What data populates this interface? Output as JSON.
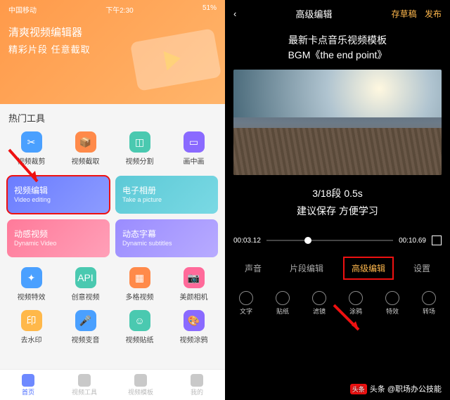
{
  "left": {
    "status": {
      "carrier": "中国移动",
      "time": "下午2:30",
      "battery": "51%"
    },
    "app_name": "清爽视频编辑器",
    "tagline": "精彩片段 任意截取",
    "section_hot": "热门工具",
    "tools_row1": [
      {
        "label": "视频裁剪",
        "color": "#4aa0ff"
      },
      {
        "label": "视频截取",
        "color": "#ff8a4a"
      },
      {
        "label": "视频分割",
        "color": "#4ac9b0"
      },
      {
        "label": "画中画",
        "color": "#8a6aff"
      }
    ],
    "cards": [
      {
        "cn": "视频编辑",
        "en": "Video editing"
      },
      {
        "cn": "电子相册",
        "en": "Take a picture"
      },
      {
        "cn": "动感视频",
        "en": "Dynamic Video"
      },
      {
        "cn": "动态字幕",
        "en": "Dynamic subtitles"
      }
    ],
    "tools_row2": [
      {
        "label": "视频特效",
        "color": "#4aa0ff"
      },
      {
        "label": "创意视频",
        "color": "#4ac9b0"
      },
      {
        "label": "多格视频",
        "color": "#ff8a4a"
      },
      {
        "label": "美颜相机",
        "color": "#ff6a9a"
      }
    ],
    "tools_row3": [
      {
        "label": "去水印",
        "color": "#ffb84a"
      },
      {
        "label": "视频变音",
        "color": "#4aa0ff"
      },
      {
        "label": "视频贴纸",
        "color": "#4ac9b0"
      },
      {
        "label": "视频涂鸦",
        "color": "#8a6aff"
      }
    ],
    "nav": [
      {
        "label": "首页",
        "active": true
      },
      {
        "label": "视频工具"
      },
      {
        "label": "视频模板"
      },
      {
        "label": "我的"
      }
    ]
  },
  "right": {
    "header": {
      "back": "‹",
      "title": "高级编辑",
      "draft": "存草稿",
      "publish": "发布"
    },
    "template_line1": "最新卡点音乐视频模板",
    "template_line2": "BGM《the end point》",
    "segment": "3/18段  0.5s",
    "hint": "建议保存      方便学习",
    "time_cur": "00:03.12",
    "time_total": "00:10.69",
    "tabs": [
      "声音",
      "片段编辑",
      "高级编辑",
      "设置"
    ],
    "active_tab": "高级编辑",
    "tools": [
      "文字",
      "贴纸",
      "滤镜",
      "涂鸦",
      "特效",
      "转场"
    ],
    "watermark": "头条 @职场办公技能"
  }
}
